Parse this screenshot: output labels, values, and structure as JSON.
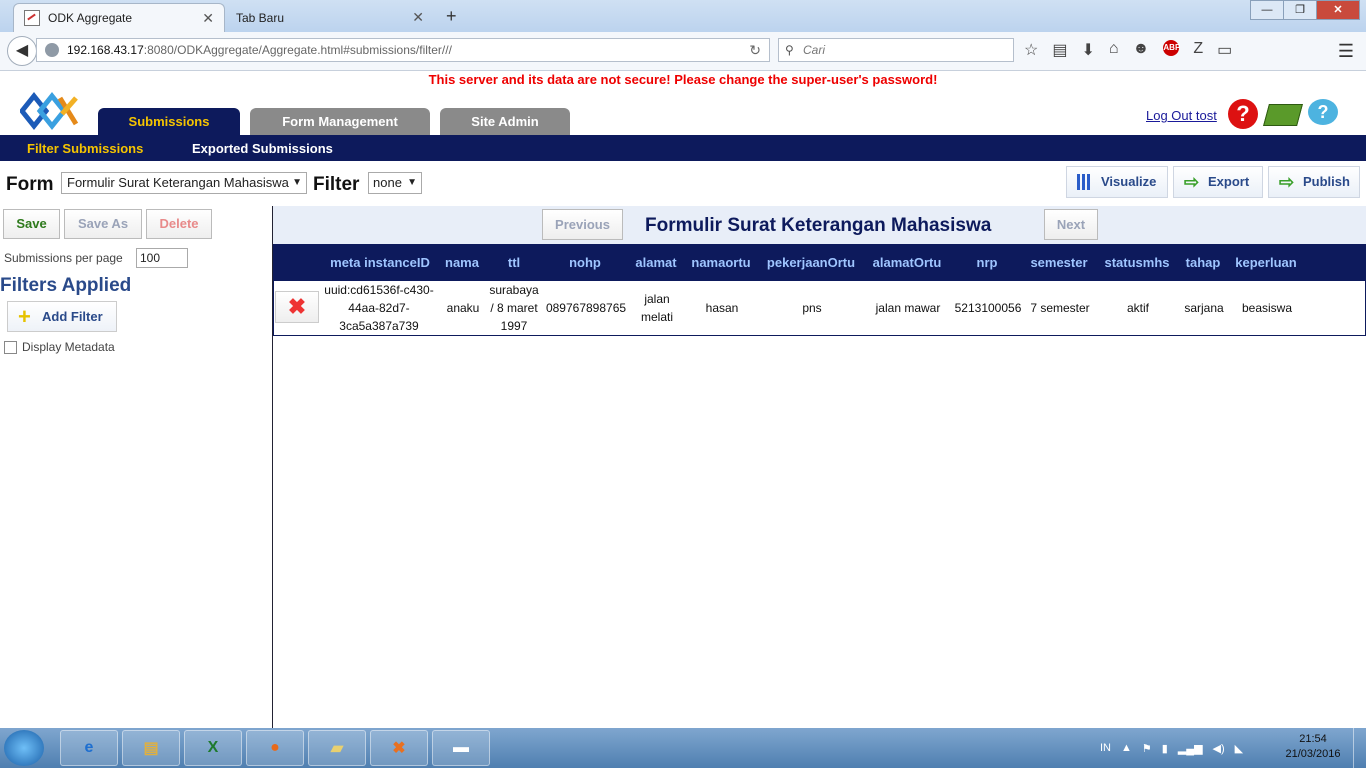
{
  "browser": {
    "tabs": [
      {
        "title": "ODK Aggregate",
        "active": true
      },
      {
        "title": "Tab Baru",
        "active": false
      }
    ],
    "url_host": "192.168.43.17",
    "url_rest": ":8080/ODKAggregate/Aggregate.html#submissions/filter///",
    "search_placeholder": "Cari"
  },
  "page": {
    "warning": "This server and its data are not secure! Please change the super-user's password!",
    "main_tabs": [
      "Submissions",
      "Form Management",
      "Site Admin"
    ],
    "logout": "Log Out tost",
    "sub_tabs": [
      "Filter Submissions",
      "Exported Submissions"
    ],
    "form_label": "Form",
    "form_value": "Formulir Surat Keterangan Mahasiswa",
    "filter_label": "Filter",
    "filter_value": "none",
    "actions": {
      "visualize": "Visualize",
      "export": "Export",
      "publish": "Publish"
    }
  },
  "left": {
    "save": "Save",
    "save_as": "Save As",
    "delete": "Delete",
    "per_page_label": "Submissions per page",
    "per_page_value": "100",
    "filters_applied": "Filters Applied",
    "add_filter": "Add Filter",
    "display_metadata": "Display Metadata"
  },
  "results": {
    "previous": "Previous",
    "next": "Next",
    "title": "Formulir Surat Keterangan Mahasiswa",
    "columns": [
      "meta instanceID",
      "nama",
      "ttl",
      "nohp",
      "alamat",
      "namaortu",
      "pekerjaanOrtu",
      "alamatOrtu",
      "nrp",
      "semester",
      "statusmhs",
      "tahap",
      "keperluan"
    ],
    "rows": [
      [
        "uuid:cd61536f-c430-44aa-82d7-3ca5a387a739",
        "anaku",
        "surabaya / 8 maret 1997",
        "089767898765",
        "jalan melati",
        "hasan",
        "pns",
        "jalan mawar",
        "5213100056",
        "7 semester",
        "aktif",
        "sarjana",
        "beasiswa"
      ]
    ]
  },
  "taskbar": {
    "lang": "IN",
    "time": "21:54",
    "date": "21/03/2016"
  }
}
